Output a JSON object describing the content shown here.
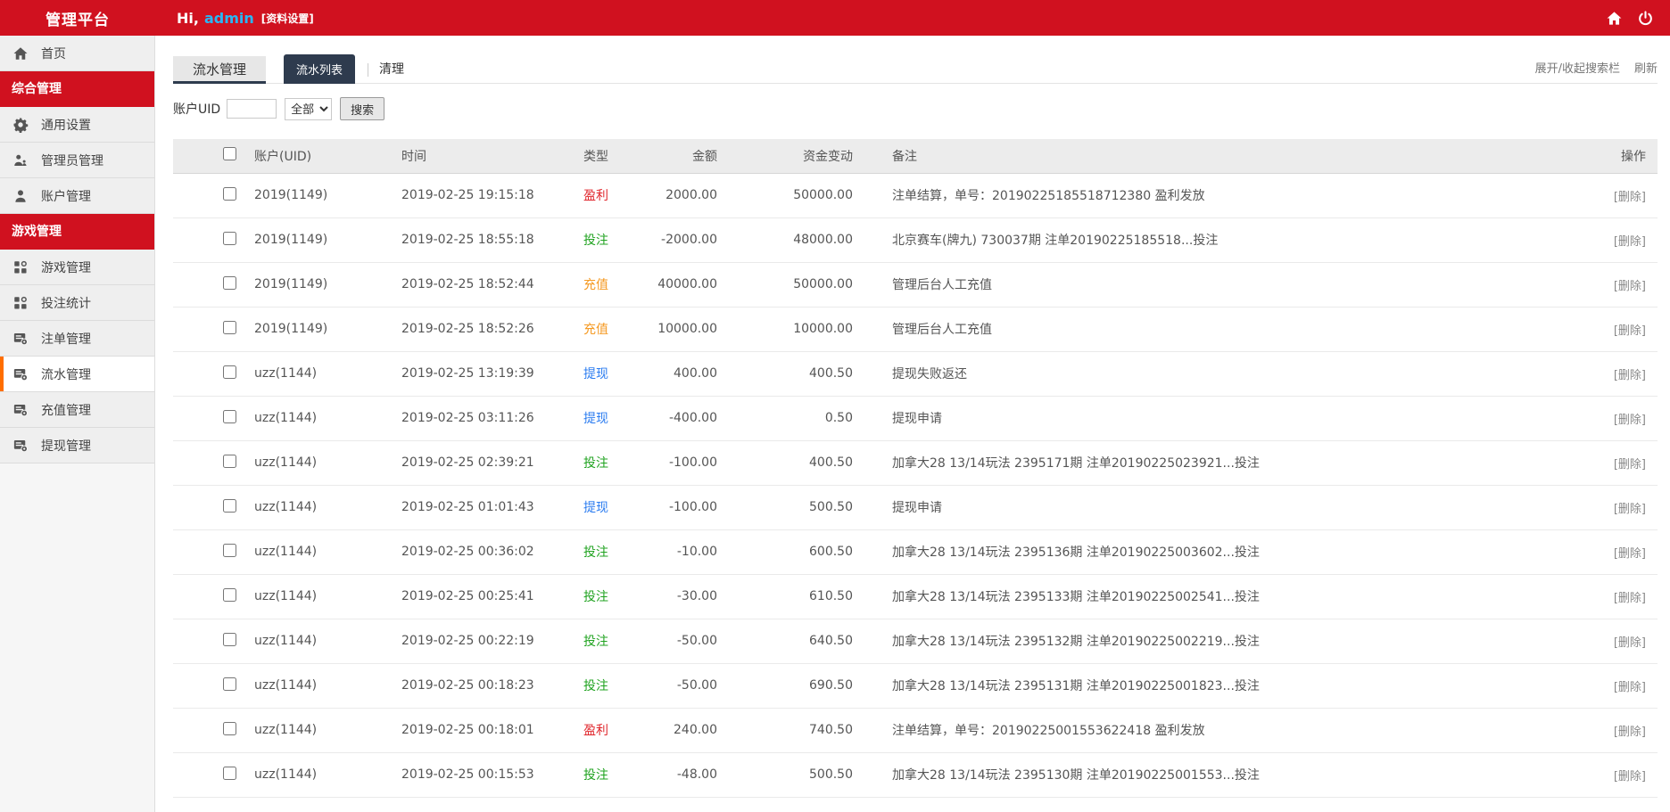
{
  "app": {
    "title": "管理平台",
    "greeting_prefix": "Hi,",
    "username": "admin",
    "profile_link": "[资料设置]"
  },
  "sidebar": {
    "items": [
      {
        "type": "link",
        "name": "home",
        "label": "首页",
        "icon": "home-icon",
        "active": false
      },
      {
        "type": "section",
        "name": "general",
        "label": "综合管理"
      },
      {
        "type": "link",
        "name": "general-settings",
        "label": "通用设置",
        "icon": "gear-icon",
        "active": false
      },
      {
        "type": "link",
        "name": "admin-management",
        "label": "管理员管理",
        "icon": "admin-group-icon",
        "active": false
      },
      {
        "type": "link",
        "name": "account-management",
        "label": "账户管理",
        "icon": "user-icon",
        "active": false
      },
      {
        "type": "section",
        "name": "game",
        "label": "游戏管理"
      },
      {
        "type": "link",
        "name": "game-management",
        "label": "游戏管理",
        "icon": "apps-icon",
        "active": false
      },
      {
        "type": "link",
        "name": "bet-statistics",
        "label": "投注统计",
        "icon": "apps-icon",
        "active": false
      },
      {
        "type": "link",
        "name": "order-management",
        "label": "注单管理",
        "icon": "register-icon",
        "active": false
      },
      {
        "type": "link",
        "name": "flow-management",
        "label": "流水管理",
        "icon": "register-icon",
        "active": true
      },
      {
        "type": "link",
        "name": "deposit-management",
        "label": "充值管理",
        "icon": "register-icon",
        "active": false
      },
      {
        "type": "link",
        "name": "withdraw-management",
        "label": "提现管理",
        "icon": "register-icon",
        "active": false
      }
    ]
  },
  "toolbar": {
    "page_tab": "流水管理",
    "tabs": [
      {
        "label": "流水列表",
        "active": true
      },
      {
        "label": "清理",
        "active": false
      }
    ],
    "expand_search_label": "展开/收起搜索栏",
    "refresh_label": "刷新"
  },
  "search": {
    "field_label": "账户UID",
    "input_value": "",
    "type_select_value": "全部",
    "search_button_label": "搜索"
  },
  "table": {
    "columns": {
      "account": "账户(UID)",
      "time": "时间",
      "type": "类型",
      "amount": "金额",
      "balance": "资金变动",
      "remark": "备注",
      "action": "操作"
    },
    "action_label": "[删除]",
    "rows": [
      {
        "account": "2019(1149)",
        "time": "2019-02-25 19:15:18",
        "type": "盈利",
        "type_key": "profit",
        "amount": "2000.00",
        "balance": "50000.00",
        "remark": "注单结算，单号：20190225185518712380 盈利发放"
      },
      {
        "account": "2019(1149)",
        "time": "2019-02-25 18:55:18",
        "type": "投注",
        "type_key": "bet",
        "amount": "-2000.00",
        "balance": "48000.00",
        "remark": "北京赛车(牌九) 730037期 注单20190225185518...投注"
      },
      {
        "account": "2019(1149)",
        "time": "2019-02-25 18:52:44",
        "type": "充值",
        "type_key": "deposit",
        "amount": "40000.00",
        "balance": "50000.00",
        "remark": "管理后台人工充值"
      },
      {
        "account": "2019(1149)",
        "time": "2019-02-25 18:52:26",
        "type": "充值",
        "type_key": "deposit",
        "amount": "10000.00",
        "balance": "10000.00",
        "remark": "管理后台人工充值"
      },
      {
        "account": "uzz(1144)",
        "time": "2019-02-25 13:19:39",
        "type": "提现",
        "type_key": "withdraw",
        "amount": "400.00",
        "balance": "400.50",
        "remark": "提现失败返还"
      },
      {
        "account": "uzz(1144)",
        "time": "2019-02-25 03:11:26",
        "type": "提现",
        "type_key": "withdraw",
        "amount": "-400.00",
        "balance": "0.50",
        "remark": "提现申请"
      },
      {
        "account": "uzz(1144)",
        "time": "2019-02-25 02:39:21",
        "type": "投注",
        "type_key": "bet",
        "amount": "-100.00",
        "balance": "400.50",
        "remark": "加拿大28 13/14玩法 2395171期 注单20190225023921...投注"
      },
      {
        "account": "uzz(1144)",
        "time": "2019-02-25 01:01:43",
        "type": "提现",
        "type_key": "withdraw",
        "amount": "-100.00",
        "balance": "500.50",
        "remark": "提现申请"
      },
      {
        "account": "uzz(1144)",
        "time": "2019-02-25 00:36:02",
        "type": "投注",
        "type_key": "bet",
        "amount": "-10.00",
        "balance": "600.50",
        "remark": "加拿大28 13/14玩法 2395136期 注单20190225003602...投注"
      },
      {
        "account": "uzz(1144)",
        "time": "2019-02-25 00:25:41",
        "type": "投注",
        "type_key": "bet",
        "amount": "-30.00",
        "balance": "610.50",
        "remark": "加拿大28 13/14玩法 2395133期 注单20190225002541...投注"
      },
      {
        "account": "uzz(1144)",
        "time": "2019-02-25 00:22:19",
        "type": "投注",
        "type_key": "bet",
        "amount": "-50.00",
        "balance": "640.50",
        "remark": "加拿大28 13/14玩法 2395132期 注单20190225002219...投注"
      },
      {
        "account": "uzz(1144)",
        "time": "2019-02-25 00:18:23",
        "type": "投注",
        "type_key": "bet",
        "amount": "-50.00",
        "balance": "690.50",
        "remark": "加拿大28 13/14玩法 2395131期 注单20190225001823...投注"
      },
      {
        "account": "uzz(1144)",
        "time": "2019-02-25 00:18:01",
        "type": "盈利",
        "type_key": "profit",
        "amount": "240.00",
        "balance": "740.50",
        "remark": "注单结算，单号：20190225001553622418 盈利发放"
      },
      {
        "account": "uzz(1144)",
        "time": "2019-02-25 00:15:53",
        "type": "投注",
        "type_key": "bet",
        "amount": "-48.00",
        "balance": "500.50",
        "remark": "加拿大28 13/14玩法 2395130期 注单20190225001553...投注"
      }
    ]
  },
  "colors": {
    "header_red": "#d0111f",
    "accent_orange": "#ff6e00",
    "tab_dark": "#2e3b4e",
    "username_blue": "#29b6f6",
    "type_profit": "#e0262c",
    "type_bet": "#21a321",
    "type_deposit": "#f59a23",
    "type_withdraw": "#2b7cf0"
  }
}
